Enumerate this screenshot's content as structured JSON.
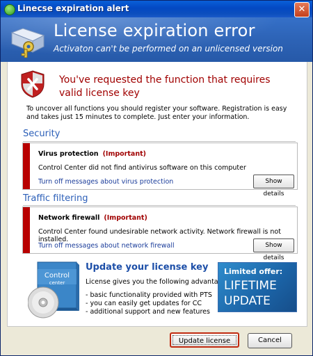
{
  "window": {
    "title": "Linecse expiration alert",
    "close_label": "✕"
  },
  "header": {
    "title": "License expiration error",
    "subtitle": "Activaton can't be performed on an unlicensed version"
  },
  "alert": {
    "message": "You've requested the function that requires valid license key",
    "intro": "To uncover all functions you should register your software. Registration is easy and takes just 15 minutes to complete. Just enter your information."
  },
  "sections": [
    {
      "title": "Security",
      "item_title": "Virus protection",
      "importance": "(Important)",
      "message": "Control Center did not find antivirus software on this computer",
      "link": "Turn off messages about virus protection",
      "button": "Show details"
    },
    {
      "title": "Traffic filtering",
      "item_title": "Network firewall",
      "importance": "(Important)",
      "message": "Control Center found undesirable network activity. Network firewall is not installed.",
      "link": "Turn off messages about network firewall",
      "button": "Show details"
    }
  ],
  "promo": {
    "box_line1": "Control",
    "box_line2": "center",
    "title": "Update your license key",
    "intro": "License gives you the following advantages:",
    "advantages": [
      "- basic functionality provided with PTS",
      "- you can easily get updates for CC",
      "- additional support and new features"
    ]
  },
  "offer": {
    "line1": "Limited offer:",
    "line2": "LIFETIME",
    "line3": "UPDATE"
  },
  "buttons": {
    "update": "Update license",
    "cancel": "Cancel"
  },
  "colors": {
    "titlebar": "#0348c2",
    "header": "#2d63b6",
    "alert_text": "#a00000",
    "section_title": "#2c5fb8",
    "warning_bar": "#b80000",
    "link": "#1a3c9a",
    "offer": "#1b63a6"
  },
  "icons": {
    "title": "green-check-icon",
    "header": "key-folder-icon",
    "alert": "shield-error-icon",
    "promo": "software-box-icon",
    "close": "close-icon"
  }
}
